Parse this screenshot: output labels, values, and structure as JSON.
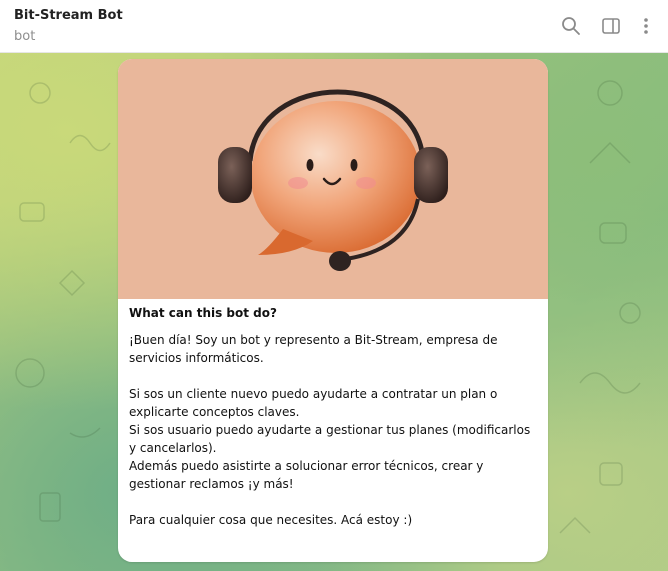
{
  "header": {
    "title": "Bit-Stream Bot",
    "subtitle": "bot",
    "icons": [
      "search-icon",
      "sidebar-toggle-icon",
      "more-vertical-icon"
    ]
  },
  "card": {
    "heading": "What can this bot do?",
    "paragraphs": [
      "¡Buen día! Soy un bot y represento a Bit-Stream, empresa de servicios informáticos.",
      "",
      "Si sos un cliente nuevo puedo ayudarte a contratar un plan o explicarte conceptos claves.",
      "Si sos usuario puedo ayudarte a gestionar tus planes (modificarlos y cancelarlos).",
      "Además puedo asistirte a solucionar error técnicos, crear y gestionar reclamos ¡y más!",
      "",
      "Para cualquier cosa que necesites. Acá estoy :)"
    ]
  },
  "colors": {
    "hero_bg": "#e9b79b",
    "accent_orange": "#d9692f"
  }
}
